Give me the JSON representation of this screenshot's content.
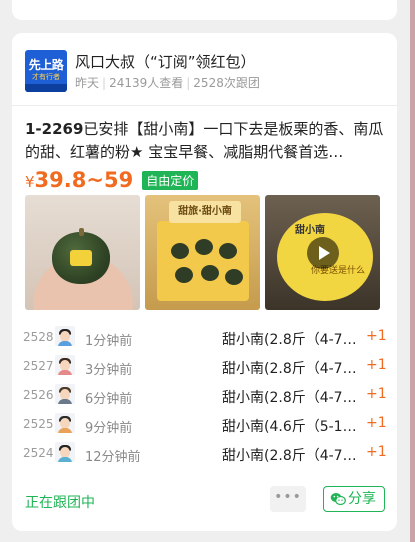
{
  "group": {
    "name": "风口大叔（“订阅”领红包）",
    "meta_day": "昨天",
    "meta_views": "24139人查看",
    "meta_follows": "2528次跟团",
    "avatar_line1": "先上路",
    "avatar_line2": "才有行者"
  },
  "product": {
    "id": "1-2269",
    "title": "已安排【甜小南】一口下去是板栗的香、南瓜的甜、红薯的粉★ 宝宝早餐、减脂期代餐首选…",
    "currency": "¥",
    "price": "39.8~59",
    "badge": "自由定价"
  },
  "photos": {
    "box_sign": "甜旅·甜小南",
    "plate_text": "甜小南",
    "plate_caption": "你要送是什么"
  },
  "orders": [
    {
      "num": "2528",
      "time": "1分钟前",
      "item": "甜小南(2.8斤（4-7…",
      "qty": "+1"
    },
    {
      "num": "2527",
      "time": "3分钟前",
      "item": "甜小南(2.8斤（4-7…",
      "qty": "+1"
    },
    {
      "num": "2526",
      "time": "6分钟前",
      "item": "甜小南(2.8斤（4-7…",
      "qty": "+1"
    },
    {
      "num": "2525",
      "time": "9分钟前",
      "item": "甜小南(4.6斤（5-1…",
      "qty": "+1"
    },
    {
      "num": "2524",
      "time": "12分钟前",
      "item": "甜小南(2.8斤（4-7…",
      "qty": "+1"
    }
  ],
  "footer": {
    "following": "正在跟团中",
    "more": "•••",
    "share": "分享"
  },
  "colors": {
    "accent_green": "#1fb455",
    "price_orange": "#f06a1f"
  }
}
